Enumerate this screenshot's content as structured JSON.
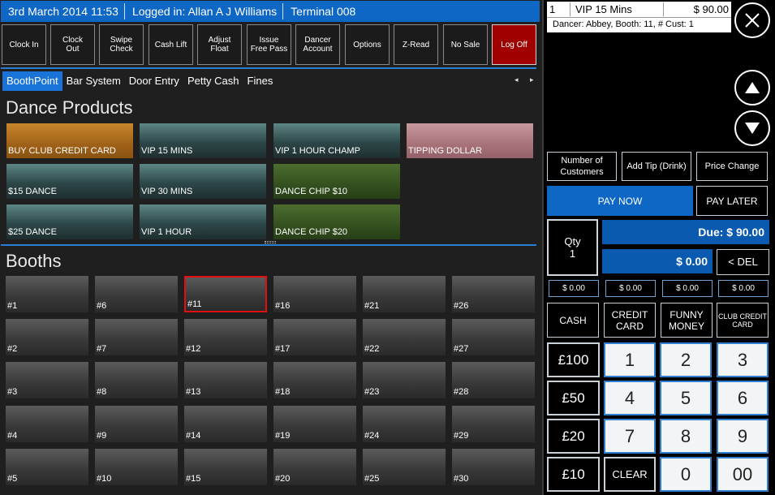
{
  "status": {
    "datetime": "3rd March 2014 11:53",
    "logged_in": "Logged in: Allan A J Williams",
    "terminal": "Terminal 008"
  },
  "toolbar": [
    {
      "label": "Clock In",
      "name": "clock-in-button"
    },
    {
      "label": "Clock\nOut",
      "name": "clock-out-button"
    },
    {
      "label": "Swipe\nCheck",
      "name": "swipe-check-button"
    },
    {
      "label": "Cash Lift",
      "name": "cash-lift-button"
    },
    {
      "label": "Adjust\nFloat",
      "name": "adjust-float-button"
    },
    {
      "label": "Issue\nFree Pass",
      "name": "issue-free-pass-button"
    },
    {
      "label": "Dancer\nAccount",
      "name": "dancer-account-button"
    },
    {
      "label": "Options",
      "name": "options-button"
    },
    {
      "label": "Z-Read",
      "name": "z-read-button"
    },
    {
      "label": "No Sale",
      "name": "no-sale-button"
    },
    {
      "label": "Log Off",
      "name": "log-off-button"
    }
  ],
  "tabs": [
    "BoothPoint",
    "Bar System",
    "Door Entry",
    "Petty Cash",
    "Fines"
  ],
  "tab_arrows": "◂ ▸",
  "dance_products": {
    "title": "Dance Products",
    "items": [
      {
        "label": "BUY CLUB CREDIT CARD",
        "color": "#a06219"
      },
      {
        "label": "VIP 15 MINS",
        "color": "#2d4748"
      },
      {
        "label": "VIP 1 HOUR CHAMP",
        "color": "#2d4748"
      },
      {
        "label": "TIPPING DOLLAR",
        "color": "#a87378"
      },
      {
        "label": "$15 DANCE",
        "color": "#2d4748"
      },
      {
        "label": "VIP 30 MINS",
        "color": "#2d4748"
      },
      {
        "label": "DANCE CHIP $10",
        "color": "#34501f"
      },
      {
        "label": "$25 DANCE",
        "color": "#2d4748"
      },
      {
        "label": "VIP 1 HOUR",
        "color": "#2d4748"
      },
      {
        "label": "DANCE CHIP $20",
        "color": "#34501f"
      }
    ]
  },
  "booths": {
    "title": "Booths",
    "selected": "#11",
    "items": [
      "#1",
      "#6",
      "#11",
      "#16",
      "#21",
      "#26",
      "#2",
      "#7",
      "#12",
      "#17",
      "#22",
      "#27",
      "#3",
      "#8",
      "#13",
      "#18",
      "#23",
      "#28",
      "#4",
      "#9",
      "#14",
      "#19",
      "#24",
      "#29",
      "#5",
      "#10",
      "#15",
      "#20",
      "#25",
      "#30"
    ]
  },
  "order": {
    "qty": "1",
    "item": "VIP 15 Mins",
    "price": "$ 90.00",
    "detail": "Dancer: Abbey, Booth: 11, # Cust: 1"
  },
  "actions": {
    "num_customers": "Number of Customers",
    "add_tip": "Add Tip (Drink)",
    "price_change": "Price Change",
    "pay_now": "PAY NOW",
    "pay_later": "PAY LATER"
  },
  "payment": {
    "qty_label": "Qty",
    "qty_value": "1",
    "due": "Due: $ 90.00",
    "tendered": "$ 0.00",
    "del": "< DEL",
    "tender_amounts": [
      "$ 0.00",
      "$ 0.00",
      "$ 0.00",
      "$ 0.00"
    ],
    "methods": [
      "CASH",
      "CREDIT CARD",
      "FUNNY MONEY",
      "CLUB CREDIT CARD"
    ],
    "notes": [
      "£100",
      "£50",
      "£20",
      "£10"
    ],
    "keys": [
      "1",
      "2",
      "3",
      "4",
      "5",
      "6",
      "7",
      "8",
      "9",
      "CLEAR",
      "0",
      "00"
    ]
  },
  "colors": {
    "accent": "#0e67c4",
    "log_off": "#a00000",
    "selected_booth": "#e01010"
  }
}
